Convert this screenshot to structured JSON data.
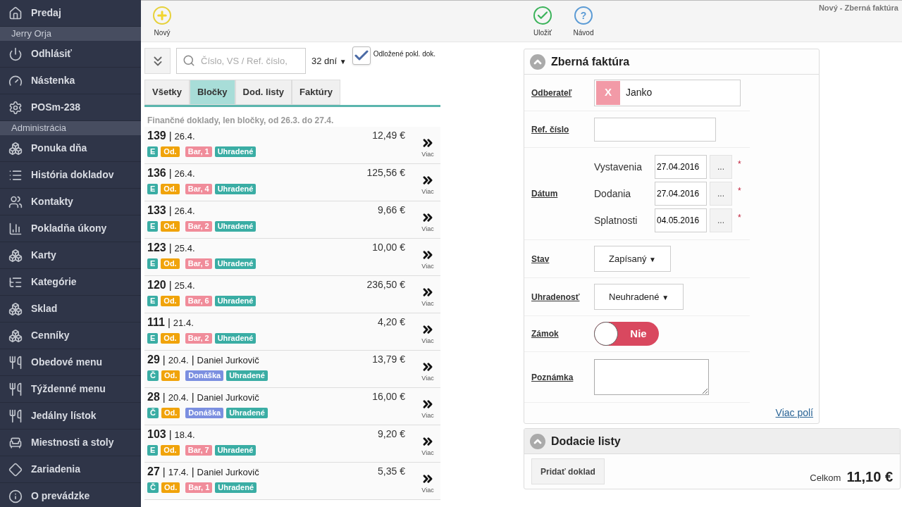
{
  "sidebar": {
    "items": [
      {
        "kind": "item",
        "label": "Predaj"
      },
      {
        "kind": "header",
        "label": "Jerry Orja"
      },
      {
        "kind": "item",
        "label": "Odhlásiť"
      },
      {
        "kind": "item",
        "label": "Nástenka"
      },
      {
        "kind": "item",
        "label": "POSm-238"
      },
      {
        "kind": "header",
        "label": "Administrácia"
      },
      {
        "kind": "item",
        "label": "Ponuka dňa"
      },
      {
        "kind": "item",
        "label": "História dokladov"
      },
      {
        "kind": "item",
        "label": "Kontakty"
      },
      {
        "kind": "item",
        "label": "Pokladňa úkony"
      },
      {
        "kind": "item",
        "label": "Karty"
      },
      {
        "kind": "item",
        "label": "Kategórie"
      },
      {
        "kind": "item",
        "label": "Sklad"
      },
      {
        "kind": "item",
        "label": "Cenníky"
      },
      {
        "kind": "item",
        "label": "Obedové menu"
      },
      {
        "kind": "item",
        "label": "Týždenné menu"
      },
      {
        "kind": "item",
        "label": "Jedálny lístok"
      },
      {
        "kind": "item",
        "label": "Miestnosti a stoly"
      },
      {
        "kind": "item",
        "label": "Zariadenia"
      },
      {
        "kind": "item",
        "label": "O prevádzke"
      }
    ]
  },
  "toolbar": {
    "left": [
      {
        "kind": "new",
        "label": "Nový"
      }
    ],
    "right": [
      {
        "kind": "save",
        "label": "Uložiť"
      },
      {
        "kind": "help",
        "label": "Návod",
        "symbol": "?"
      }
    ],
    "page_title": "Nový - Zberná faktúra"
  },
  "filter": {
    "search_placeholder": "Číslo, VS / Ref. číslo,",
    "period": "32 dní",
    "period_caret": "▼",
    "deferred": {
      "label": "Odložené pokl. dok.",
      "checked": true
    }
  },
  "tabs": [
    {
      "label": "Všetky",
      "selected": false
    },
    {
      "label": "Bločky",
      "selected": true
    },
    {
      "label": "Dod. listy",
      "selected": false
    },
    {
      "label": "Faktúry",
      "selected": false
    }
  ],
  "list": {
    "caption": "Finančné doklady, len bločky, od 26.3. do 27.4.",
    "rows": [
      {
        "number": "139",
        "sep": "|",
        "date": "26.4.",
        "amount": "12,49 €",
        "more": "Viac",
        "badges": [
          {
            "text": "E",
            "color": "#3aada4"
          },
          {
            "text": "Od.",
            "color": "#f0a30a"
          },
          {
            "text": "Bar, 1",
            "color": "#f08c9a"
          },
          {
            "text": "Uhradené",
            "color": "#3aada4"
          }
        ]
      },
      {
        "number": "136",
        "sep": "|",
        "date": "26.4.",
        "amount": "125,56 €",
        "more": "Viac",
        "badges": [
          {
            "text": "E",
            "color": "#3aada4"
          },
          {
            "text": "Od.",
            "color": "#f0a30a"
          },
          {
            "text": "Bar, 4",
            "color": "#f08c9a"
          },
          {
            "text": "Uhradené",
            "color": "#3aada4"
          }
        ]
      },
      {
        "number": "133",
        "sep": "|",
        "date": "26.4.",
        "amount": "9,66 €",
        "more": "Viac",
        "badges": [
          {
            "text": "E",
            "color": "#3aada4"
          },
          {
            "text": "Od.",
            "color": "#f0a30a"
          },
          {
            "text": "Bar, 2",
            "color": "#f08c9a"
          },
          {
            "text": "Uhradené",
            "color": "#3aada4"
          }
        ]
      },
      {
        "number": "123",
        "sep": "|",
        "date": "25.4.",
        "amount": "10,00 €",
        "more": "Viac",
        "badges": [
          {
            "text": "E",
            "color": "#3aada4"
          },
          {
            "text": "Od.",
            "color": "#f0a30a"
          },
          {
            "text": "Bar, 5",
            "color": "#f08c9a"
          },
          {
            "text": "Uhradené",
            "color": "#3aada4"
          }
        ]
      },
      {
        "number": "120",
        "sep": "|",
        "date": "25.4.",
        "amount": "236,50 €",
        "more": "Viac",
        "badges": [
          {
            "text": "E",
            "color": "#3aada4"
          },
          {
            "text": "Od.",
            "color": "#f0a30a"
          },
          {
            "text": "Bar, 6",
            "color": "#f08c9a"
          },
          {
            "text": "Uhradené",
            "color": "#3aada4"
          }
        ]
      },
      {
        "number": "111",
        "sep": "|",
        "date": "21.4.",
        "amount": "4,20 €",
        "more": "Viac",
        "badges": [
          {
            "text": "E",
            "color": "#3aada4"
          },
          {
            "text": "Od.",
            "color": "#f0a30a"
          },
          {
            "text": "Bar, 2",
            "color": "#f08c9a"
          },
          {
            "text": "Uhradené",
            "color": "#3aada4"
          }
        ]
      },
      {
        "number": "29",
        "sep": "|",
        "date": "20.4.",
        "sep2": "|",
        "customer": "Daniel Jurkovič",
        "amount": "13,79 €",
        "more": "Viac",
        "badges": [
          {
            "text": "Č",
            "color": "#3aada4"
          },
          {
            "text": "Od.",
            "color": "#f0a30a"
          },
          {
            "text": "Donáška",
            "color": "#7b8fe0"
          },
          {
            "text": "Uhradené",
            "color": "#3aada4"
          }
        ]
      },
      {
        "number": "28",
        "sep": "|",
        "date": "20.4.",
        "sep2": "|",
        "customer": "Daniel Jurkovič",
        "amount": "16,00 €",
        "more": "Viac",
        "badges": [
          {
            "text": "Č",
            "color": "#3aada4"
          },
          {
            "text": "Od.",
            "color": "#f0a30a"
          },
          {
            "text": "Donáška",
            "color": "#7b8fe0"
          },
          {
            "text": "Uhradené",
            "color": "#3aada4"
          }
        ]
      },
      {
        "number": "103",
        "sep": "|",
        "date": "18.4.",
        "amount": "9,20 €",
        "more": "Viac",
        "badges": [
          {
            "text": "E",
            "color": "#3aada4"
          },
          {
            "text": "Od.",
            "color": "#f0a30a"
          },
          {
            "text": "Bar, 7",
            "color": "#f08c9a"
          },
          {
            "text": "Uhradené",
            "color": "#3aada4"
          }
        ]
      },
      {
        "number": "27",
        "sep": "|",
        "date": "17.4.",
        "sep2": "|",
        "customer": "Daniel Jurkovič",
        "amount": "5,35 €",
        "more": "Viac",
        "badges": [
          {
            "text": "Č",
            "color": "#3aada4"
          },
          {
            "text": "Od.",
            "color": "#f0a30a"
          },
          {
            "text": "Bar, 1",
            "color": "#f08c9a"
          },
          {
            "text": "Uhradené",
            "color": "#3aada4"
          }
        ]
      }
    ]
  },
  "invoice": {
    "title": "Zberná faktúra",
    "fields": [
      {
        "kind": "chip",
        "label": "Odberateľ",
        "remove": "X",
        "value": "Janko"
      },
      {
        "kind": "text",
        "label": "Ref. číslo"
      },
      {
        "kind": "dates",
        "label": "Dátum",
        "dates": [
          {
            "label": "Vystavenia",
            "value": "27.04.2016",
            "button": "...",
            "mark": "*"
          },
          {
            "label": "Dodania",
            "value": "27.04.2016",
            "button": "...",
            "mark": "*"
          },
          {
            "label": "Splatnosti",
            "value": "04.05.2016",
            "button": "...",
            "mark": "*"
          }
        ]
      },
      {
        "kind": "select",
        "label": "Stav",
        "value": "Zapísaný",
        "caret": "▼"
      },
      {
        "kind": "select",
        "label": "Uhradenosť",
        "value": "Neuhradené",
        "caret": "▼"
      },
      {
        "kind": "toggle",
        "label": "Zámok",
        "on": false,
        "text": "Nie"
      },
      {
        "kind": "textarea",
        "label": "Poznámka"
      }
    ],
    "more_link": "Viac polí"
  },
  "delivery": {
    "title": "Dodacie listy",
    "add_button": "Pridať doklad",
    "total_label": "Celkom",
    "total": "11,10 €"
  }
}
